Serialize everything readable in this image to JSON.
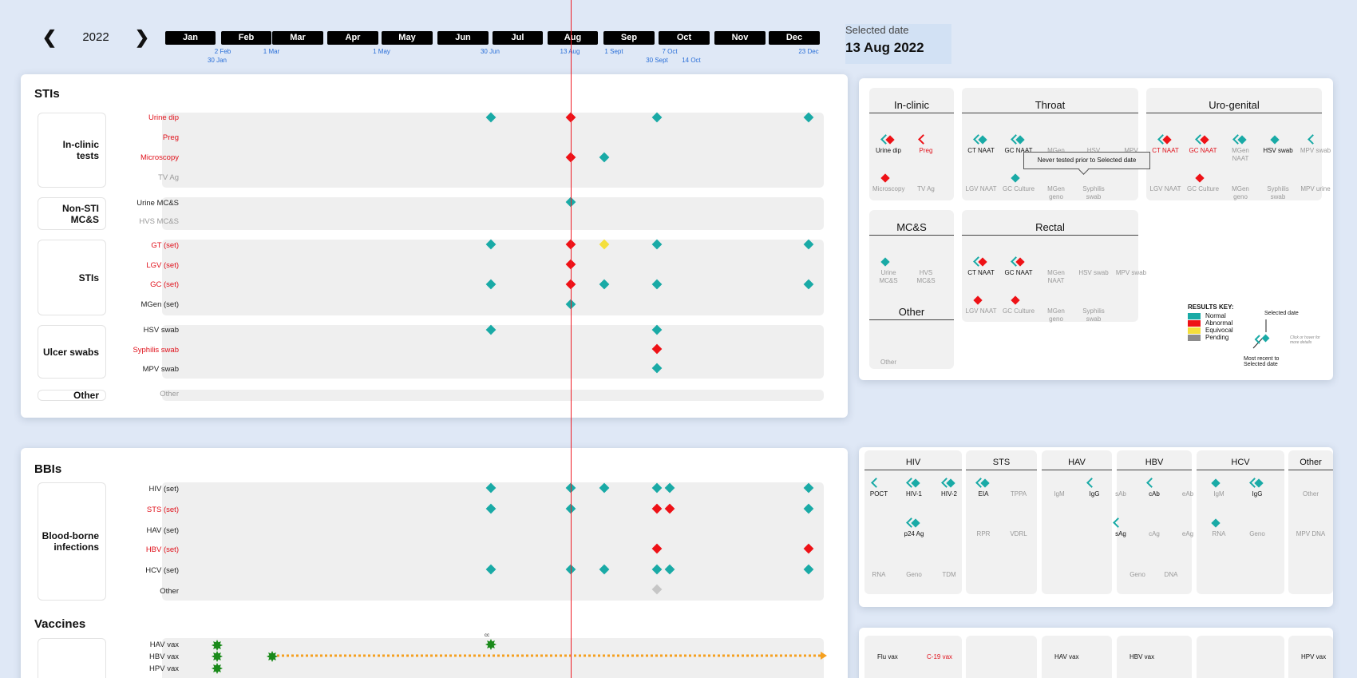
{
  "nav": {
    "year": "2022",
    "prev_icon": "chevron-left-icon",
    "next_icon": "chevron-right-icon"
  },
  "months": [
    "Jan",
    "Feb",
    "Mar",
    "Apr",
    "May",
    "Jun",
    "Jul",
    "Aug",
    "Sep",
    "Oct",
    "Nov",
    "Dec"
  ],
  "ticks": [
    "2 Feb",
    "30 Jan",
    "1 Mar",
    "1 May",
    "30 Jun",
    "13 Aug",
    "1 Sept",
    "7 Oct",
    "30 Sept",
    "14 Oct",
    "23 Dec"
  ],
  "selected": {
    "label": "Selected date",
    "value": "13 Aug 2022"
  },
  "stis": {
    "title": "STIs",
    "groups": [
      {
        "label": "In-clinic tests",
        "rows": [
          {
            "label": "Urine dip",
            "color": "red"
          },
          {
            "label": "Preg",
            "color": "red"
          },
          {
            "label": "Microscopy",
            "color": "red"
          },
          {
            "label": "TV Ag",
            "color": "grey"
          }
        ]
      },
      {
        "label": "Non-STI MC&S",
        "rows": [
          {
            "label": "Urine MC&S",
            "color": "black"
          },
          {
            "label": "HVS MC&S",
            "color": "grey"
          }
        ]
      },
      {
        "label": "STIs",
        "rows": [
          {
            "label": "GT (set)",
            "color": "red"
          },
          {
            "label": "LGV (set)",
            "color": "red"
          },
          {
            "label": "GC (set)",
            "color": "red"
          },
          {
            "label": "MGen (set)",
            "color": "black"
          }
        ]
      },
      {
        "label": "Ulcer swabs",
        "rows": [
          {
            "label": "HSV swab",
            "color": "black"
          },
          {
            "label": "Syphilis swab",
            "color": "red"
          },
          {
            "label": "MPV swab",
            "color": "black"
          }
        ]
      },
      {
        "label": "Other",
        "rows": [
          {
            "label": "Other",
            "color": "grey"
          }
        ]
      }
    ]
  },
  "bbis": {
    "title": "BBIs",
    "groups": [
      {
        "label": "Blood-borne infections",
        "rows": [
          {
            "label": "HIV (set)",
            "color": "black"
          },
          {
            "label": "STS (set)",
            "color": "red"
          },
          {
            "label": "HAV (set)",
            "color": "black"
          },
          {
            "label": "HBV (set)",
            "color": "red"
          },
          {
            "label": "HCV (set)",
            "color": "black"
          },
          {
            "label": "Other",
            "color": "black"
          }
        ]
      }
    ]
  },
  "vaccines": {
    "title": "Vaccines",
    "rows": [
      "HAV vax",
      "HBV vax",
      "HPV vax"
    ],
    "cc_label": "cc"
  },
  "colors": {
    "normal": "#19aaa6",
    "abnormal": "#ee1116",
    "equivocal": "#f4df3c",
    "pending": "#8c8c8c",
    "date_line": "#ee1c25"
  },
  "right": {
    "panels": [
      {
        "title": "In-clinic",
        "items": [
          {
            "label": "Urine dip",
            "color": "black"
          },
          {
            "label": "Preg",
            "color": "red"
          },
          {
            "label": "Microscopy",
            "color": "grey"
          },
          {
            "label": "TV Ag",
            "color": "grey"
          }
        ]
      },
      {
        "title": "Throat",
        "items": [
          {
            "label": "CT NAAT",
            "color": "black"
          },
          {
            "label": "GC NAAT",
            "color": "black"
          },
          {
            "label": "MGen",
            "color": "grey"
          },
          {
            "label": "HSV",
            "color": "grey"
          },
          {
            "label": "MPV",
            "color": "grey"
          },
          {
            "label": "LGV NAAT",
            "color": "grey"
          },
          {
            "label": "GC Culture",
            "color": "grey"
          },
          {
            "label": "MGen geno",
            "color": "grey"
          },
          {
            "label": "Syphilis swab",
            "color": "grey"
          }
        ]
      },
      {
        "title": "Uro-genital",
        "items": [
          {
            "label": "CT NAAT",
            "color": "red"
          },
          {
            "label": "GC NAAT",
            "color": "red"
          },
          {
            "label": "MGen NAAT",
            "color": "grey"
          },
          {
            "label": "HSV swab",
            "color": "black"
          },
          {
            "label": "MPV swab",
            "color": "grey"
          },
          {
            "label": "LGV NAAT",
            "color": "grey"
          },
          {
            "label": "GC Culture",
            "color": "grey"
          },
          {
            "label": "MGen geno",
            "color": "grey"
          },
          {
            "label": "Syphilis swab",
            "color": "grey"
          },
          {
            "label": "MPV urine",
            "color": "grey"
          }
        ]
      },
      {
        "title": "MC&S",
        "items": [
          {
            "label": "Urine MC&S",
            "color": "grey"
          },
          {
            "label": "HVS MC&S",
            "color": "grey"
          }
        ]
      },
      {
        "title": "Rectal",
        "items": [
          {
            "label": "CT NAAT",
            "color": "black"
          },
          {
            "label": "GC NAAT",
            "color": "black"
          },
          {
            "label": "MGen NAAT",
            "color": "grey"
          },
          {
            "label": "HSV swab",
            "color": "grey"
          },
          {
            "label": "MPV swab",
            "color": "grey"
          },
          {
            "label": "LGV NAAT",
            "color": "grey"
          },
          {
            "label": "GC Culture",
            "color": "grey"
          },
          {
            "label": "MGen geno",
            "color": "grey"
          },
          {
            "label": "Syphilis swab",
            "color": "grey"
          }
        ]
      },
      {
        "title": "Other",
        "items": [
          {
            "label": "Other",
            "color": "grey"
          }
        ]
      }
    ],
    "tooltip": "Never tested prior to Selected date",
    "key": {
      "title": "RESULTS KEY:",
      "items": [
        "Normal",
        "Abnormal",
        "Equivocal",
        "Pending"
      ],
      "selected_date": "Selected date",
      "click_hint": "Click or hover for more details",
      "most_recent": "Most recent to Selected date"
    },
    "bbi_panels": [
      {
        "title": "HIV",
        "items": [
          {
            "label": "POCT",
            "color": "black"
          },
          {
            "label": "HIV-1",
            "color": "black"
          },
          {
            "label": "HIV-2",
            "color": "black"
          },
          {
            "label": "p24 Ag",
            "color": "black"
          },
          {
            "label": "RNA",
            "color": "grey"
          },
          {
            "label": "Geno",
            "color": "grey"
          },
          {
            "label": "TDM",
            "color": "grey"
          }
        ]
      },
      {
        "title": "STS",
        "items": [
          {
            "label": "EIA",
            "color": "black"
          },
          {
            "label": "TPPA",
            "color": "grey"
          },
          {
            "label": "RPR",
            "color": "grey"
          },
          {
            "label": "VDRL",
            "color": "grey"
          }
        ]
      },
      {
        "title": "HAV",
        "items": [
          {
            "label": "IgM",
            "color": "grey"
          },
          {
            "label": "IgG",
            "color": "black"
          }
        ]
      },
      {
        "title": "HBV",
        "items": [
          {
            "label": "sAb",
            "color": "grey"
          },
          {
            "label": "cAb",
            "color": "black"
          },
          {
            "label": "eAb",
            "color": "grey"
          },
          {
            "label": "sAg",
            "color": "black"
          },
          {
            "label": "cAg",
            "color": "grey"
          },
          {
            "label": "eAg",
            "color": "grey"
          },
          {
            "label": "Geno",
            "color": "grey"
          },
          {
            "label": "DNA",
            "color": "grey"
          }
        ]
      },
      {
        "title": "HCV",
        "items": [
          {
            "label": "IgM",
            "color": "grey"
          },
          {
            "label": "IgG",
            "color": "black"
          },
          {
            "label": "RNA",
            "color": "grey"
          },
          {
            "label": "Geno",
            "color": "grey"
          }
        ]
      },
      {
        "title": "Other",
        "items": [
          {
            "label": "Other",
            "color": "grey"
          },
          {
            "label": "MPV DNA",
            "color": "grey"
          }
        ]
      }
    ],
    "vax_panels": [
      {
        "items": [
          {
            "label": "Flu vax",
            "color": "black"
          },
          {
            "label": "C-19 vax",
            "color": "red"
          }
        ]
      },
      {
        "items": []
      },
      {
        "items": [
          {
            "label": "HAV vax",
            "color": "black"
          }
        ]
      },
      {
        "items": [
          {
            "label": "HBV vax",
            "color": "black"
          }
        ]
      },
      {
        "items": []
      },
      {
        "items": [
          {
            "label": "HPV vax",
            "color": "black"
          }
        ]
      }
    ]
  }
}
